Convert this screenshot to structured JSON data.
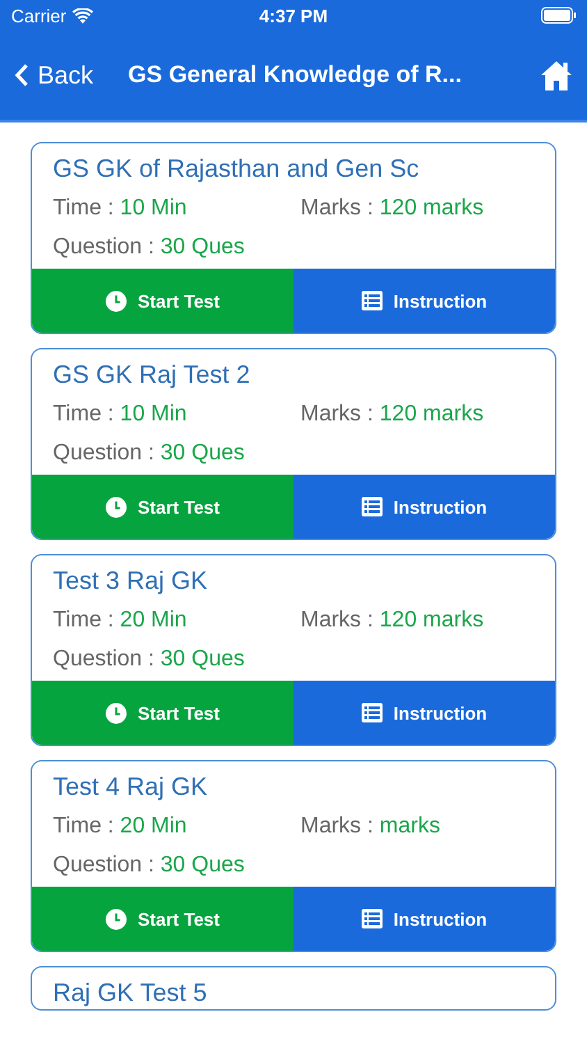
{
  "status_bar": {
    "carrier": "Carrier",
    "time": "4:37 PM"
  },
  "nav": {
    "back": "Back",
    "title": "GS General Knowledge of R..."
  },
  "tests": [
    {
      "title": "GS GK of Rajasthan and Gen Sc",
      "time_label": "Time : ",
      "time": "10 Min",
      "marks_label": "Marks : ",
      "marks": "120 marks",
      "question_label": "Question : ",
      "questions": "30 Ques",
      "start": "Start Test",
      "instruction": "Instruction"
    },
    {
      "title": "GS GK Raj Test 2",
      "time_label": "Time : ",
      "time": "10 Min",
      "marks_label": "Marks : ",
      "marks": "120 marks",
      "question_label": "Question : ",
      "questions": "30 Ques",
      "start": "Start Test",
      "instruction": "Instruction"
    },
    {
      "title": "Test 3 Raj GK",
      "time_label": "Time : ",
      "time": "20 Min",
      "marks_label": "Marks : ",
      "marks": "120 marks",
      "question_label": "Question : ",
      "questions": "30 Ques",
      "start": "Start Test",
      "instruction": "Instruction"
    },
    {
      "title": "Test 4 Raj GK",
      "time_label": "Time : ",
      "time": "20 Min",
      "marks_label": "Marks : ",
      "marks": "marks",
      "question_label": "Question : ",
      "questions": "30 Ques",
      "start": "Start Test",
      "instruction": "Instruction"
    },
    {
      "title": "Raj GK Test 5"
    }
  ]
}
